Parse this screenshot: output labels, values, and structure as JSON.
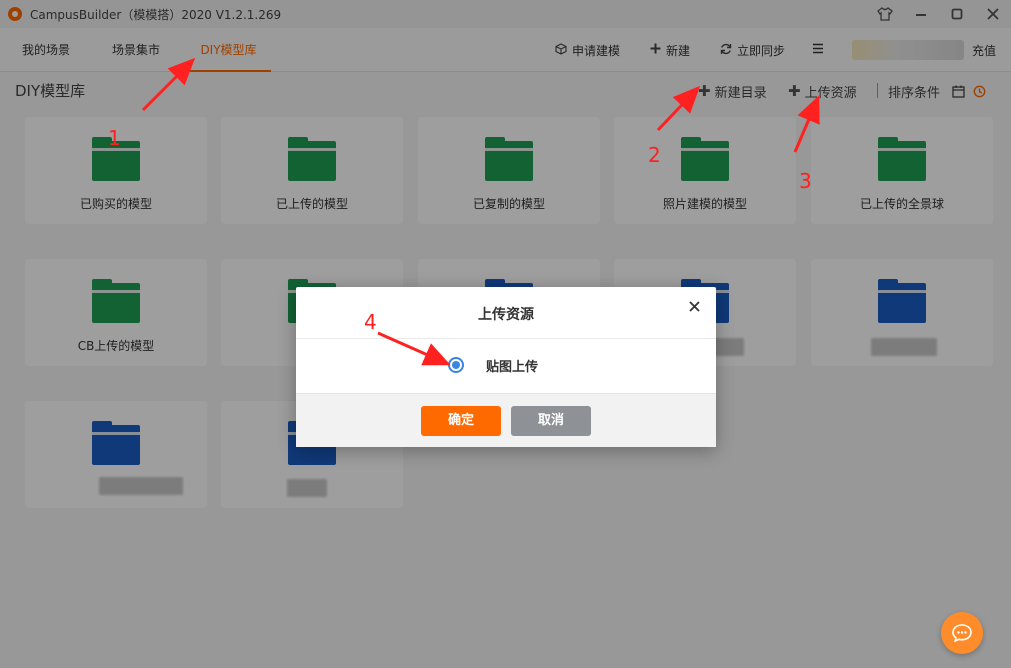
{
  "app": {
    "title": "CampusBuilder（模模搭）2020  V1.2.1.269"
  },
  "window_controls": {
    "skin": "shirt-icon",
    "minimize": "minimize-icon",
    "maximize": "maximize-icon",
    "close": "close-icon"
  },
  "nav": {
    "tabs": [
      {
        "label": "我的场景"
      },
      {
        "label": "场景集市"
      },
      {
        "label": "DIY模型库",
        "active": true
      }
    ],
    "actions": [
      {
        "label": "申请建模",
        "icon": "cube-icon"
      },
      {
        "label": "新建",
        "icon": "plus-icon"
      },
      {
        "label": "立即同步",
        "icon": "sync-icon"
      },
      {
        "label": "",
        "icon": "menu-icon"
      }
    ],
    "recharge": "充值"
  },
  "page": {
    "title": "DIY模型库",
    "tools": {
      "new_dir": "新建目录",
      "upload": "上传资源",
      "sort": "排序条件"
    }
  },
  "cards": [
    {
      "label": "已购买的模型",
      "color": "green"
    },
    {
      "label": "已上传的模型",
      "color": "green"
    },
    {
      "label": "已复制的模型",
      "color": "green"
    },
    {
      "label": "照片建模的模型",
      "color": "green"
    },
    {
      "label": "已上传的全景球",
      "color": "green"
    },
    {
      "label": "CB上传的模型",
      "color": "green"
    },
    {
      "label": "",
      "color": "green"
    },
    {
      "label": "",
      "color": "blue"
    },
    {
      "label": "",
      "color": "blue"
    },
    {
      "label": "",
      "color": "blue"
    },
    {
      "label": "",
      "color": "blue"
    },
    {
      "label": "",
      "color": "blue"
    }
  ],
  "modal": {
    "title": "上传资源",
    "option": "贴图上传",
    "ok": "确定",
    "cancel": "取消"
  },
  "annotations": [
    "1",
    "2",
    "3",
    "4"
  ],
  "colors": {
    "accent": "#ff6a00",
    "green": "#1e9f55",
    "blue": "#1a5cc4",
    "radio": "#3a85e0"
  }
}
